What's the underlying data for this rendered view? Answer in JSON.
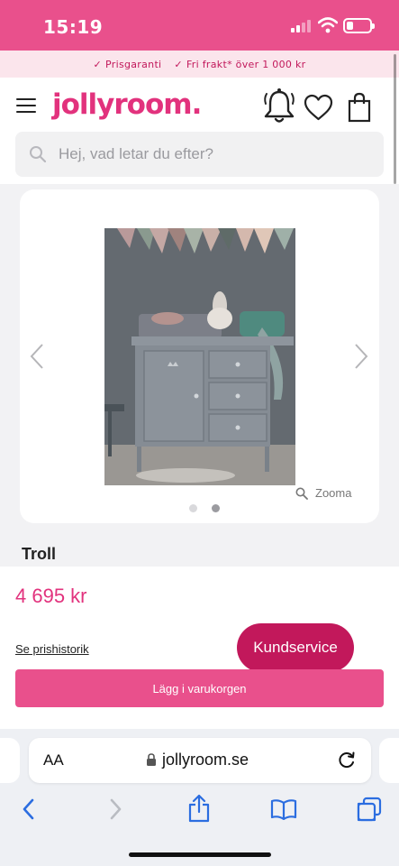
{
  "status_bar": {
    "time": "15:19",
    "battery_level": 0.3
  },
  "promo": {
    "items": [
      "Prisgaranti",
      "Fri frakt* över 1 000 kr"
    ],
    "check_icon": "check-icon"
  },
  "header": {
    "logo": "jollyroom.",
    "brand_color": "#e2327d",
    "icons": [
      "menu-icon",
      "bell-icon",
      "heart-icon",
      "shopping-bag-icon"
    ]
  },
  "search": {
    "placeholder": "Hej, vad letar du efter?"
  },
  "gallery": {
    "zoom_label": "Zooma",
    "image_count": 2,
    "active_index": 1,
    "image_description": "grey changing table dresser with drawers"
  },
  "product": {
    "name": "Troll",
    "price": "4 695 kr",
    "price_history_link": "Se prishistorik",
    "customer_service": "Kundservice",
    "add_to_cart": "Lägg i varukorgen"
  },
  "browser": {
    "text_size_label": "AA",
    "url": "jollyroom.se",
    "toolbar_icons": [
      "back-icon",
      "forward-icon",
      "share-icon",
      "bookmarks-icon",
      "tabs-icon"
    ]
  },
  "colors": {
    "primary_pink": "#e9508c",
    "dark_pink": "#c2185b",
    "price_pink": "#e2327d"
  }
}
